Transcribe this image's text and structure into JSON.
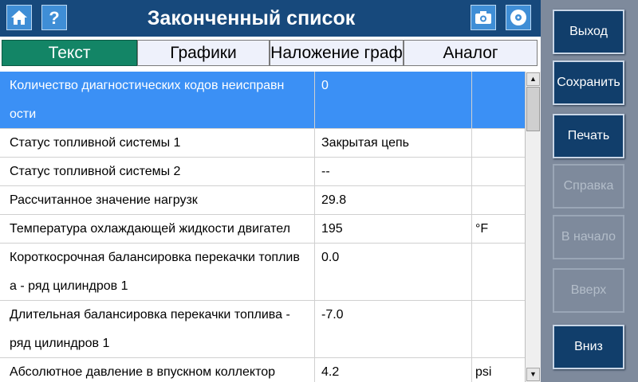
{
  "header": {
    "title": "Законченный список",
    "left_buttons": [
      "home-icon",
      "help-icon"
    ],
    "right_buttons": [
      "camera-icon",
      "disc-icon"
    ]
  },
  "tabs": [
    {
      "label": "Текст",
      "active": true
    },
    {
      "label": "Графики",
      "active": false
    },
    {
      "label": "Наложение граф",
      "active": false
    },
    {
      "label": "Аналог",
      "active": false
    }
  ],
  "rows": [
    {
      "name_lines": [
        "Количество диагностических кодов неисправн",
        "ости"
      ],
      "value": "0",
      "unit": "",
      "selected": true
    },
    {
      "name_lines": [
        "Статус топливной системы 1"
      ],
      "value": "Закрытая цепь",
      "unit": "",
      "selected": false
    },
    {
      "name_lines": [
        "Статус топливной системы 2"
      ],
      "value": "--",
      "unit": "",
      "selected": false
    },
    {
      "name_lines": [
        "Рассчитанное значение нагрузк"
      ],
      "value": "29.8",
      "unit": "",
      "selected": false
    },
    {
      "name_lines": [
        "Температура охлаждающей жидкости двигател"
      ],
      "value": "195",
      "unit": "°F",
      "selected": false
    },
    {
      "name_lines": [
        "Короткосрочная балансировка перекачки топлив",
        "а - ряд цилиндров 1"
      ],
      "value": "0.0",
      "unit": "",
      "selected": false
    },
    {
      "name_lines": [
        "Длительная балансировка перекачки топлива -",
        "ряд цилиндров 1"
      ],
      "value": "-7.0",
      "unit": "",
      "selected": false
    },
    {
      "name_lines": [
        "Абсолютное давление в впускном коллектор"
      ],
      "value": "4.2",
      "unit": "psi",
      "selected": false
    }
  ],
  "side_buttons": [
    {
      "label": "Выход",
      "enabled": true
    },
    {
      "label": "Сохранить",
      "enabled": true
    },
    {
      "label": "Печать",
      "enabled": true
    },
    {
      "label": "Справка",
      "enabled": false
    },
    {
      "label": "В начало",
      "enabled": false
    },
    {
      "label": "Вверх",
      "enabled": false
    },
    {
      "label": "Вниз",
      "enabled": true
    }
  ],
  "colors": {
    "header_bg": "#17497c",
    "tab_active": "#138566",
    "row_selected": "#3b90f5",
    "side_panel": "#7e8a9c",
    "side_button": "#113e6b"
  }
}
